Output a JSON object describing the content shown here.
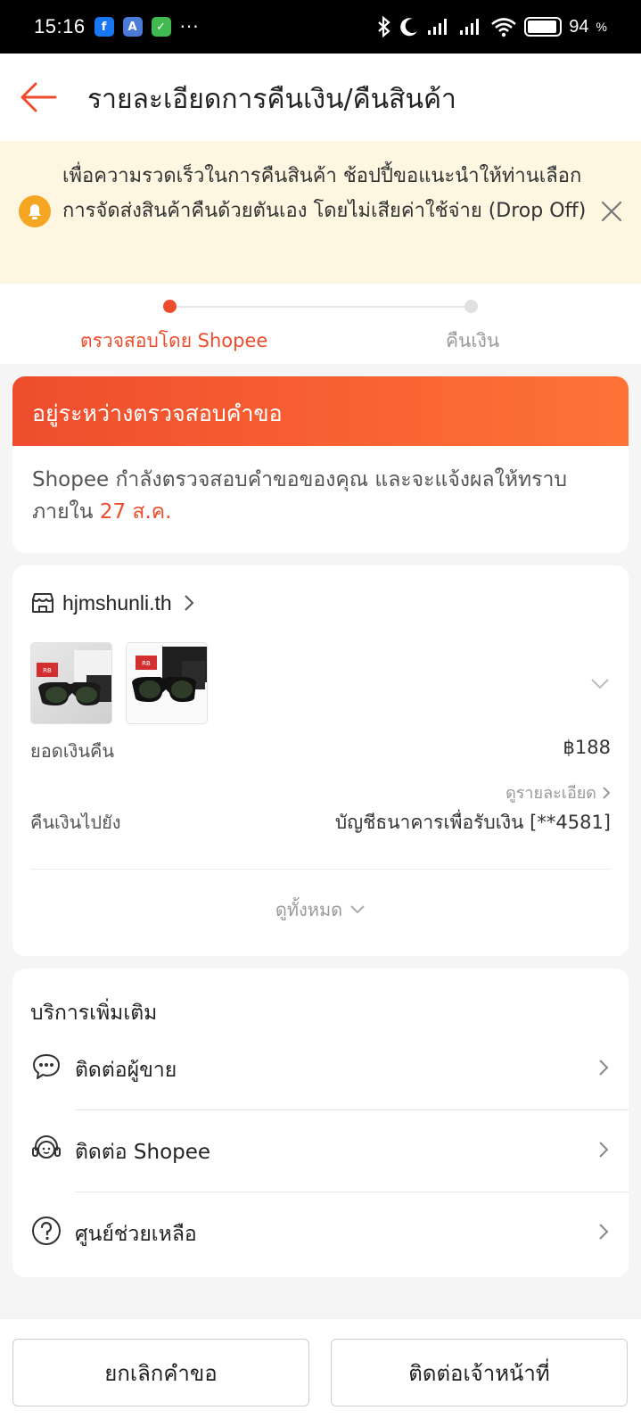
{
  "status_bar": {
    "time": "15:16",
    "battery": "94",
    "battery_level": 0.94,
    "app_icons": [
      "facebook-icon",
      "translate-icon",
      "shield-icon"
    ],
    "overflow": "···"
  },
  "header": {
    "title": "รายละเอียดการคืนเงิน/คืนสินค้า"
  },
  "notice": {
    "text": "เพื่อความรวดเร็วในการคืนสินค้า ช้อปปี้ขอแนะนำให้ท่านเลือกการจัดส่งสินค้าคืนด้วยตันเอง โดยไม่เสียค่าใช้จ่าย (Drop Off)"
  },
  "steps": {
    "items": [
      {
        "label": "ตรวจสอบโดย Shopee",
        "active": true
      },
      {
        "label": "คืนเงิน",
        "active": false
      }
    ]
  },
  "status_card": {
    "heading": "อยู่ระหว่างตรวจสอบคำขอ",
    "body_prefix": "Shopee กำลังตรวจสอบคำขอของคุณ และจะแจ้งผลให้ทราบภายใน",
    "date": "27 ส.ค."
  },
  "order": {
    "shop_name": "hjmshunli.th",
    "refund_label": "ยอดเงินคืน",
    "refund_amount": "฿188",
    "detail_link": "ดูรายละเอียด",
    "refund_to_label": "คืนเงินไปยัง",
    "refund_to_value": "บัญชีธนาคารเพื่อรับเงิน [**4581]",
    "see_all": "ดูทั้งหมด"
  },
  "services": {
    "title": "บริการเพิ่มเติม",
    "items": [
      {
        "label": "ติดต่อผู้ขาย",
        "icon": "chat-icon"
      },
      {
        "label": "ติดต่อ Shopee",
        "icon": "support-agent-icon"
      },
      {
        "label": "ศูนย์ช่วยเหลือ",
        "icon": "help-icon"
      }
    ]
  },
  "bottom": {
    "cancel_label": "ยกเลิกคำขอ",
    "contact_label": "ติดต่อเจ้าหน้าที่"
  },
  "colors": {
    "accent": "#ee4d2d",
    "accent_light": "#ff7337",
    "notice_bg": "#fdf6e1",
    "bell": "#f5a623"
  }
}
